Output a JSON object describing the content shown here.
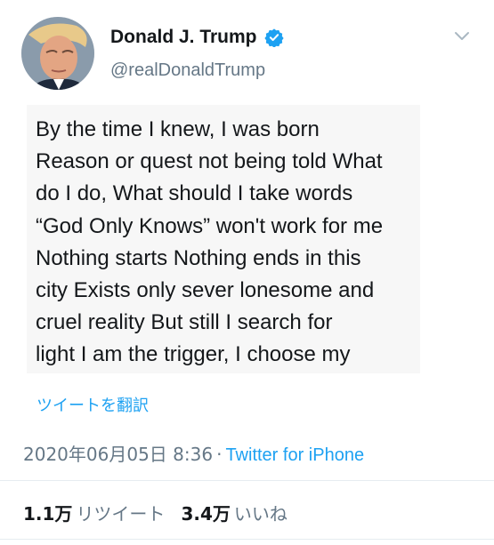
{
  "profile": {
    "display_name": "Donald J. Trump",
    "handle": "@realDonaldTrump",
    "verified": true,
    "verified_icon": "verified-badge-icon",
    "menu_icon": "chevron-down-icon"
  },
  "tweet": {
    "text": "By the time I knew, I was born\nReason or quest not being told What\ndo I do, What should I take words\n“God Only Knows” won't work for me\nNothing starts Nothing ends in this\ncity Exists only sever lonesome and\ncruel reality But still I search for\nlight I am the trigger, I choose my",
    "translate_label": "ツイートを翻訳",
    "datetime": "2020年06月05日 8:36",
    "separator": "·",
    "source": "Twitter for iPhone"
  },
  "stats": {
    "retweets_count": "1.1万",
    "retweets_label": "リツイート",
    "likes_count": "3.4万",
    "likes_label": "いいね"
  },
  "colors": {
    "accent": "#1da1f2",
    "secondary_text": "#657786",
    "primary_text": "#14171a",
    "divider": "#e6ecf0"
  }
}
